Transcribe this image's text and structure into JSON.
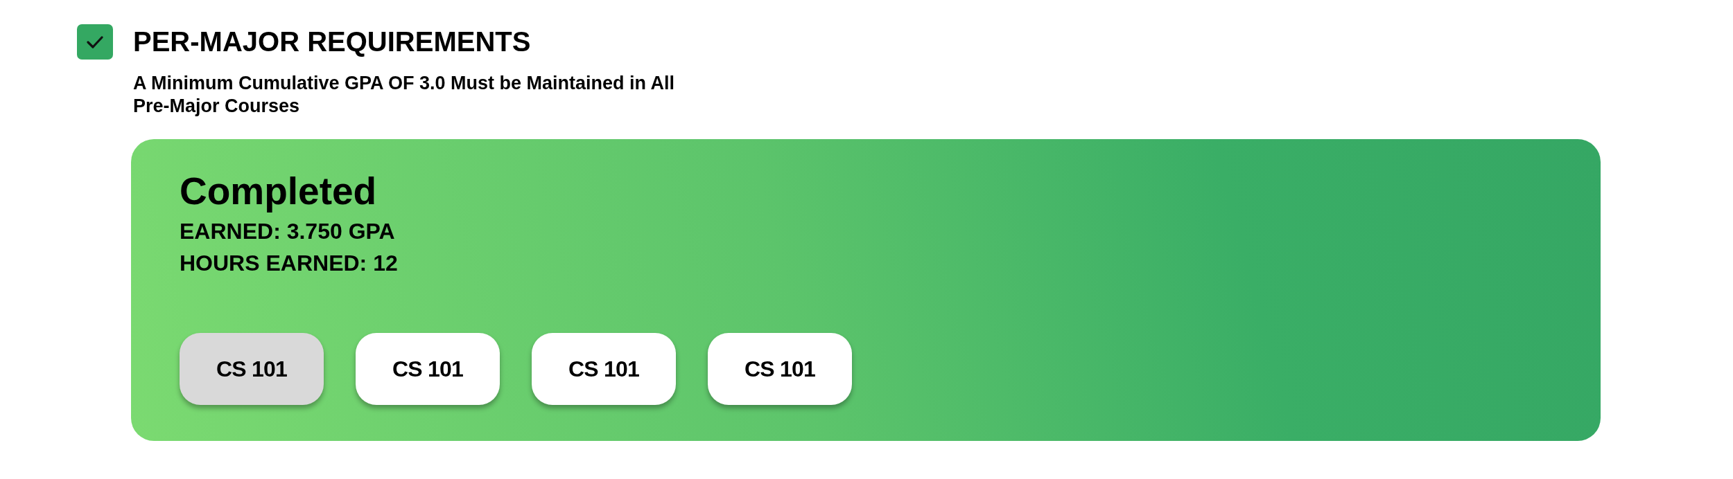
{
  "requirement": {
    "checked": true,
    "title": "PER-MAJOR REQUIREMENTS",
    "description": "A Minimum Cumulative GPA OF 3.0 Must be Maintained in All Pre-Major Courses"
  },
  "status_card": {
    "status": "Completed",
    "earned": "EARNED: 3.750 GPA",
    "hours": "HOURS EARNED: 12",
    "courses": [
      {
        "label": "CS 101",
        "selected": true
      },
      {
        "label": "CS 101",
        "selected": false
      },
      {
        "label": "CS 101",
        "selected": false
      },
      {
        "label": "CS 101",
        "selected": false
      }
    ]
  }
}
